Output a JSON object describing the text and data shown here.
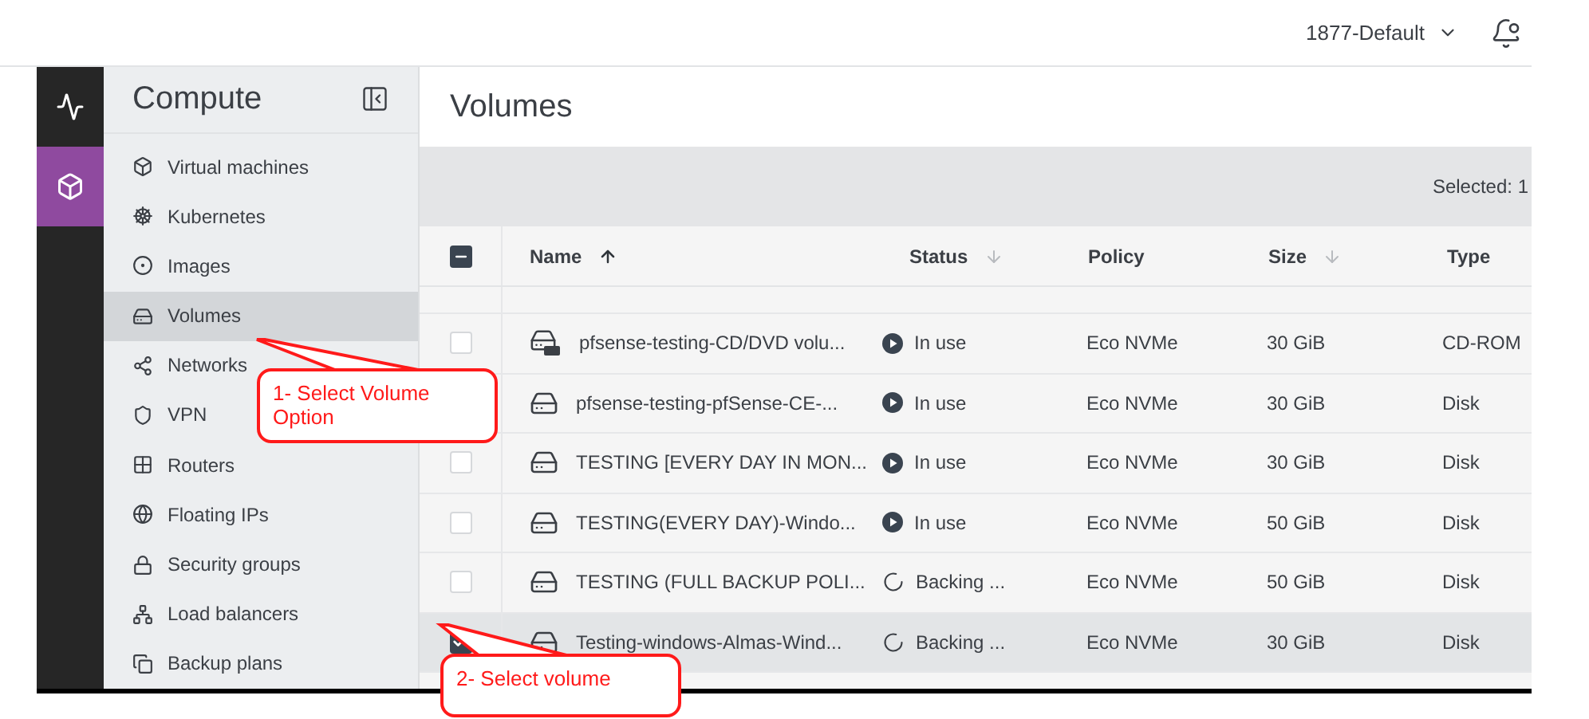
{
  "top_bar": {
    "project": "1877-Default"
  },
  "rail": [
    {
      "selected": false
    },
    {
      "selected": true
    }
  ],
  "sidebar": {
    "title": "Compute",
    "items": [
      {
        "label": "Virtual machines",
        "selected": false
      },
      {
        "label": "Kubernetes",
        "selected": false
      },
      {
        "label": "Images",
        "selected": false
      },
      {
        "label": "Volumes",
        "selected": true
      },
      {
        "label": "Networks",
        "selected": false
      },
      {
        "label": "VPN",
        "selected": false
      },
      {
        "label": "Routers",
        "selected": false
      },
      {
        "label": "Floating IPs",
        "selected": false
      },
      {
        "label": "Security groups",
        "selected": false
      },
      {
        "label": "Load balancers",
        "selected": false
      },
      {
        "label": "Backup plans",
        "selected": false
      }
    ]
  },
  "page": {
    "title": "Volumes",
    "selection": "Selected: 1"
  },
  "table": {
    "select_all": {
      "indeterminate": true
    },
    "columns": [
      {
        "label": "Name",
        "sorted": true
      },
      {
        "label": "Status",
        "sorted": false
      },
      {
        "label": "Policy"
      },
      {
        "label": "Size",
        "sorted": false
      },
      {
        "label": "Type"
      }
    ],
    "rows": [
      {
        "kind": "cd",
        "name": "pfsense-testing-CD/DVD volu...",
        "busy": false,
        "status": "In use",
        "policy": "Eco NVMe",
        "size": "30 GiB",
        "type": "CD-ROM",
        "checked": false,
        "selected": false
      },
      {
        "kind": "disk",
        "name": "pfsense-testing-pfSense-CE-...",
        "busy": false,
        "status": "In use",
        "policy": "Eco NVMe",
        "size": "30 GiB",
        "type": "Disk",
        "selected": false
      },
      {
        "kind": "disk",
        "name": "TESTING [EVERY DAY IN MON...",
        "busy": false,
        "status": "In use",
        "policy": "Eco NVMe",
        "size": "30 GiB",
        "type": "Disk",
        "checked": false,
        "selected": false
      },
      {
        "kind": "disk",
        "name": "TESTING(EVERY DAY)-Windo...",
        "busy": false,
        "status": "In use",
        "policy": "Eco NVMe",
        "size": "50 GiB",
        "type": "Disk",
        "checked": false,
        "selected": false
      },
      {
        "kind": "disk",
        "name": "TESTING (FULL BACKUP POLI...",
        "busy": true,
        "status": "Backing ...",
        "policy": "Eco NVMe",
        "size": "50 GiB",
        "type": "Disk",
        "checked": false,
        "selected": false
      },
      {
        "kind": "disk",
        "name": "Testing-windows-Almas-Wind...",
        "busy": true,
        "status": "Backing ...",
        "policy": "Eco NVMe",
        "size": "30 GiB",
        "type": "Disk",
        "checked": true,
        "selected": true
      }
    ]
  },
  "callouts": [
    {
      "text": "1- Select Volume Option"
    },
    {
      "text": "2- Select volume"
    }
  ]
}
